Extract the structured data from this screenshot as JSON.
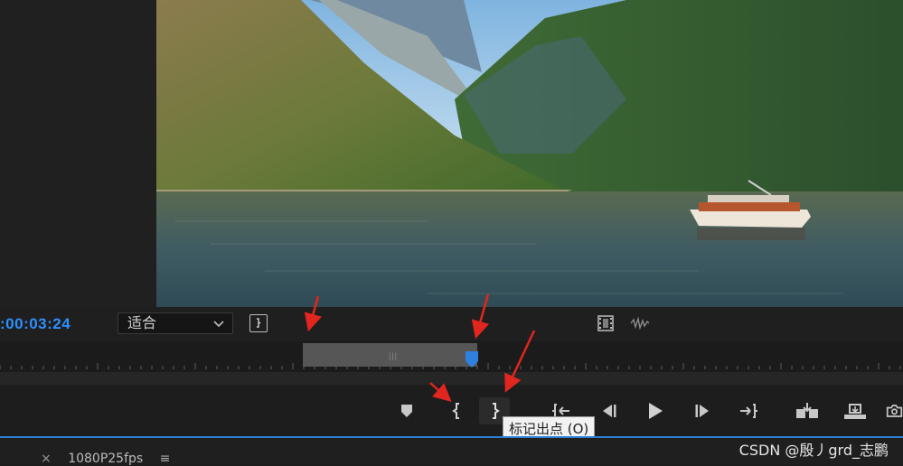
{
  "monitor": {
    "timecode": ":00:03:24",
    "zoom_label": "适合"
  },
  "tooltip": {
    "text": "标记出点 (O)"
  },
  "sequence_tab": {
    "close": "×",
    "name": "1080P25fps",
    "menu": "≡"
  },
  "watermark": "CSDN @殷丿grd_志鹏",
  "icons": {
    "marker": "marker-icon",
    "mark_in": "mark-in-icon",
    "mark_out": "mark-out-icon",
    "go_to_in": "go-to-in-icon",
    "step_back": "step-back-icon",
    "play": "play-icon",
    "step_forward": "step-forward-icon",
    "go_to_out": "go-to-out-icon",
    "insert": "insert-icon",
    "overwrite": "overwrite-icon",
    "export_frame": "camera-icon"
  },
  "colors": {
    "timecode": "#2e8fff",
    "accent_line": "#2d7fd3",
    "annotation_arrows": "#e0261e"
  }
}
